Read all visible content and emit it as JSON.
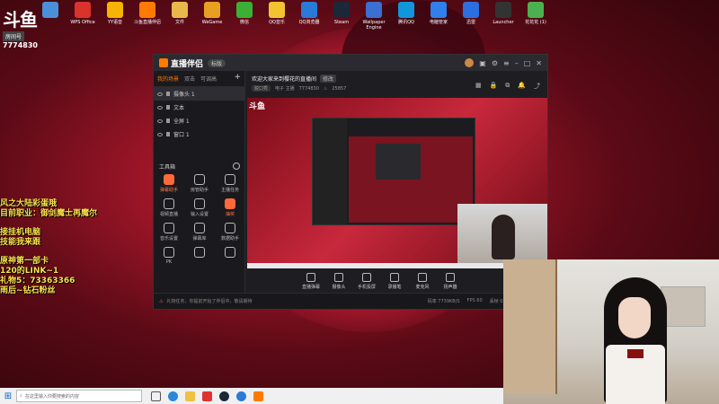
{
  "watermark": {
    "logo": "斗鱼",
    "room_label": "房间号",
    "room_number": "7774830"
  },
  "desktop_icons": [
    {
      "label": "",
      "color": "#4a90d9"
    },
    {
      "label": "WPS Office",
      "color": "#d9332b"
    },
    {
      "label": "YY语音",
      "color": "#f4b400"
    },
    {
      "label": "斗鱼直播伴侣",
      "color": "#ff7a00"
    },
    {
      "label": "文件",
      "color": "#e8b84a"
    },
    {
      "label": "WeGame",
      "color": "#e8a020"
    },
    {
      "label": "微信",
      "color": "#3cb034"
    },
    {
      "label": "QQ音乐",
      "color": "#f4c430"
    },
    {
      "label": "QQ浏览器",
      "color": "#2a7bd8"
    },
    {
      "label": "Steam",
      "color": "#1b2838"
    },
    {
      "label": "Wallpaper Engine",
      "color": "#3b6fd1"
    },
    {
      "label": "腾讯QQ",
      "color": "#1296db"
    },
    {
      "label": "电脑管家",
      "color": "#2f80ed"
    },
    {
      "label": "迅雷",
      "color": "#2b6fe0"
    },
    {
      "label": "Launcher",
      "color": "#333333"
    },
    {
      "label": "花花花 (1)",
      "color": "#4caf50"
    }
  ],
  "overlay_text": [
    "风之大陆彩蛋哦",
    "目前职业：御剑魔士再魔尔",
    "",
    "接挂机电脑",
    "技能我来跟",
    "",
    "原神第一部卡",
    "120的LINK~1",
    "礼物5：73363366",
    "雨后~钻石粉丝"
  ],
  "app": {
    "title": "直播伴侣",
    "badge": "标版",
    "sidebar_tabs": [
      "我的场景",
      "双击",
      "可调高"
    ],
    "sources": [
      {
        "label": "摄像头 1",
        "selected": true
      },
      {
        "label": "文本",
        "selected": false
      },
      {
        "label": "全屏 1",
        "selected": false
      },
      {
        "label": "窗口 1",
        "selected": false
      }
    ],
    "tools_title": "工具箱",
    "tools": [
      {
        "label": "弹幕助手",
        "hot": true
      },
      {
        "label": "房管助手",
        "hot": false
      },
      {
        "label": "主播任务",
        "hot": false
      },
      {
        "label": "视频直播",
        "hot": false
      },
      {
        "label": "输入设置",
        "hot": false
      },
      {
        "label": "抽奖",
        "hot": true
      },
      {
        "label": "音乐设置",
        "hot": false
      },
      {
        "label": "弹幕库",
        "hot": false
      },
      {
        "label": "数据助手",
        "hot": false
      },
      {
        "label": "PK",
        "hot": false
      },
      {
        "label": "",
        "hot": false
      },
      {
        "label": "",
        "hot": false
      }
    ],
    "live_title": "欢迎大家来到樱花的直播间",
    "live_title_tag": "修改",
    "category": "脱口秀",
    "sub_category": "电子 主播",
    "room_id": "7774830",
    "viewers": "25857",
    "controls": [
      "直播弹幕",
      "摄像头",
      "手机投屏",
      "录播笔",
      "麦克风",
      "扬声器"
    ],
    "status_warning": "礼物任务，你提前开始了伴侣中，敬请期待",
    "status_stats": [
      "码率 7739KB/S",
      "FPS 60",
      "丢帧 0.00%",
      "CPU 23%"
    ]
  },
  "taskbar": {
    "search_placeholder": "在这里输入你要搜索的内容"
  }
}
